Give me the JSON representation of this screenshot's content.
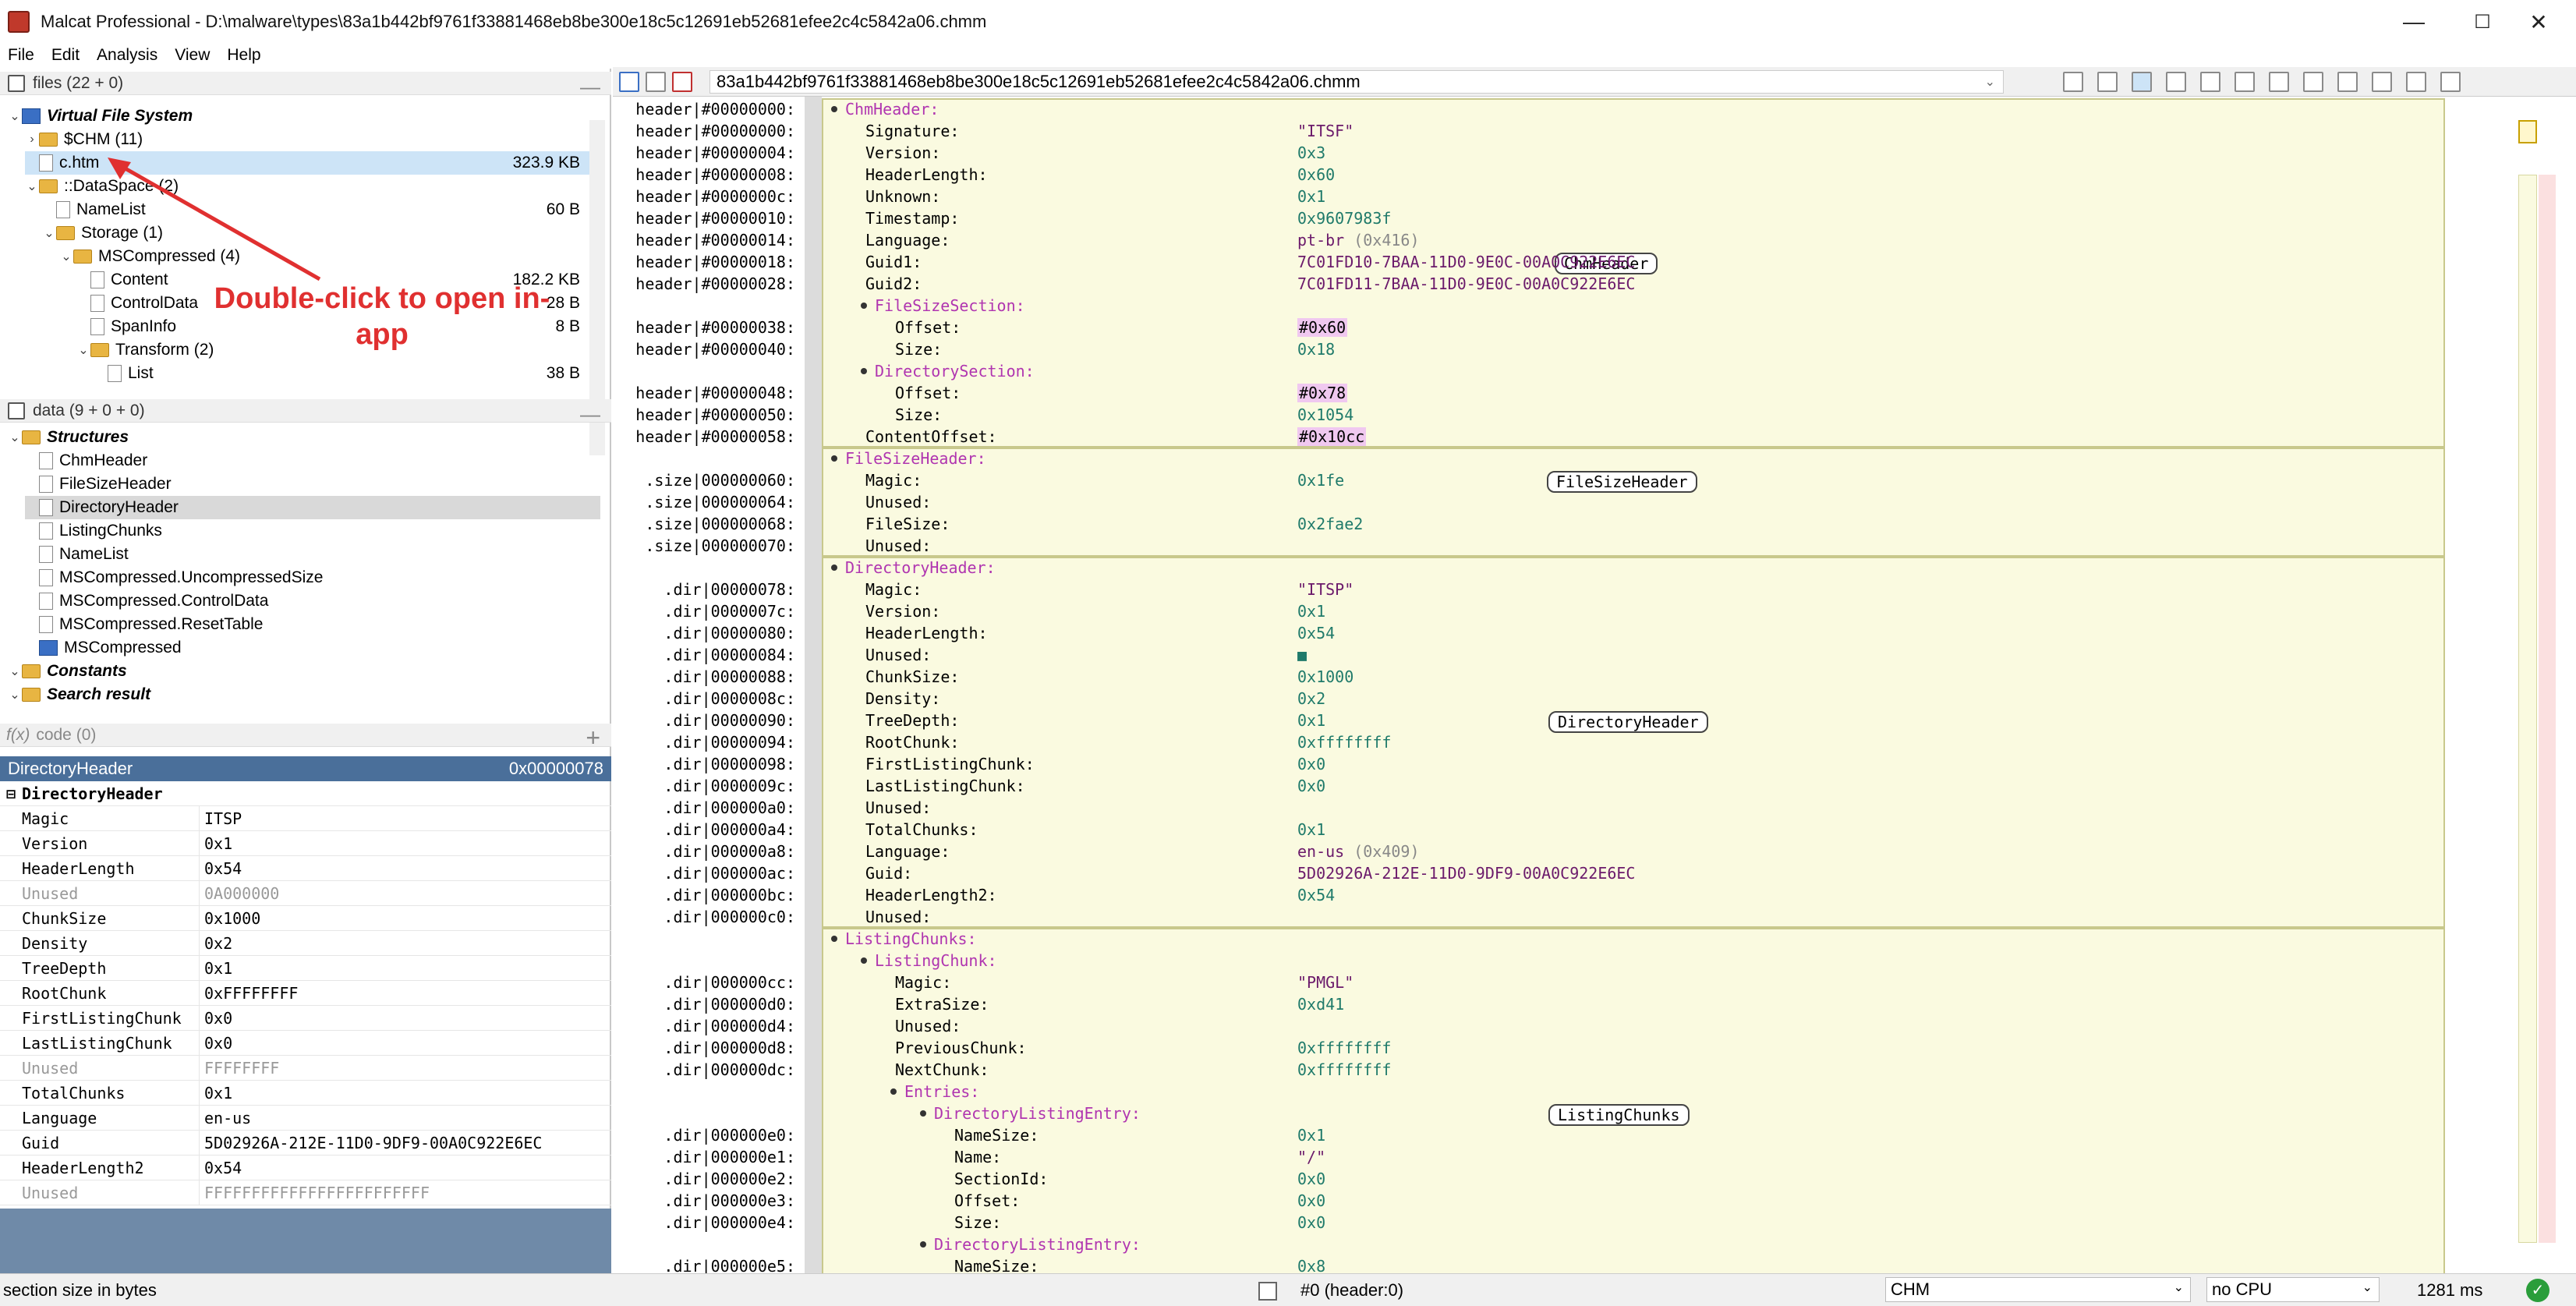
{
  "window": {
    "title": "Malcat Professional - D:\\malware\\types\\83a1b442bf9761f33881468eb8be300e18c5c12691eb52681efee2c4c5842a06.chmm",
    "min": "—",
    "max": "☐",
    "close": "✕"
  },
  "menu": [
    "File",
    "Edit",
    "Analysis",
    "View",
    "Help"
  ],
  "files_pane": {
    "header": "files (22 + 0)",
    "tree": [
      {
        "label": "Virtual File System",
        "kind": "vfs",
        "depth": 0,
        "tw": "v"
      },
      {
        "label": "$CHM (11)",
        "kind": "folder",
        "depth": 1,
        "tw": ">"
      },
      {
        "label": "c.htm",
        "kind": "file",
        "depth": 1,
        "tw": "",
        "size": "323.9 KB",
        "selected": true
      },
      {
        "label": "::DataSpace (2)",
        "kind": "folder",
        "depth": 1,
        "tw": "v"
      },
      {
        "label": "NameList",
        "kind": "file",
        "depth": 2,
        "tw": "",
        "size": "60 B"
      },
      {
        "label": "Storage (1)",
        "kind": "folder",
        "depth": 2,
        "tw": "v"
      },
      {
        "label": "MSCompressed (4)",
        "kind": "folder",
        "depth": 3,
        "tw": "v"
      },
      {
        "label": "Content",
        "kind": "file",
        "depth": 4,
        "tw": "",
        "size": "182.2 KB"
      },
      {
        "label": "ControlData",
        "kind": "file",
        "depth": 4,
        "tw": "",
        "size": "28 B"
      },
      {
        "label": "SpanInfo",
        "kind": "file",
        "depth": 4,
        "tw": "",
        "size": "8 B"
      },
      {
        "label": "Transform (2)",
        "kind": "folder",
        "depth": 4,
        "tw": "v"
      },
      {
        "label": "List",
        "kind": "file",
        "depth": 5,
        "tw": "",
        "size": "38 B"
      }
    ]
  },
  "data_pane": {
    "header": "data (9 + 0 + 0)",
    "tree": [
      {
        "label": "Structures",
        "kind": "group",
        "depth": 0
      },
      {
        "label": "ChmHeader",
        "kind": "file",
        "depth": 1
      },
      {
        "label": "FileSizeHeader",
        "kind": "file",
        "depth": 1
      },
      {
        "label": "DirectoryHeader",
        "kind": "file",
        "depth": 1,
        "selected": true
      },
      {
        "label": "ListingChunks",
        "kind": "file",
        "depth": 1
      },
      {
        "label": "NameList",
        "kind": "file",
        "depth": 1
      },
      {
        "label": "MSCompressed.UncompressedSize",
        "kind": "file",
        "depth": 1
      },
      {
        "label": "MSCompressed.ControlData",
        "kind": "file",
        "depth": 1
      },
      {
        "label": "MSCompressed.ResetTable",
        "kind": "file",
        "depth": 1
      },
      {
        "label": "MSCompressed",
        "kind": "struct",
        "depth": 1
      },
      {
        "label": "Constants",
        "kind": "group",
        "depth": 0
      },
      {
        "label": "Search result",
        "kind": "group",
        "depth": 0
      }
    ]
  },
  "code_pane": {
    "header": "code (0)",
    "fx": "f(x)",
    "plus": "+"
  },
  "props": {
    "title": "DirectoryHeader",
    "offset": "0x00000078",
    "group": "DirectoryHeader",
    "rows": [
      {
        "k": "Magic",
        "v": "ITSP"
      },
      {
        "k": "Version",
        "v": "0x1"
      },
      {
        "k": "HeaderLength",
        "v": "0x54"
      },
      {
        "k": "Unused",
        "v": "0A000000",
        "dim": true
      },
      {
        "k": "ChunkSize",
        "v": "0x1000"
      },
      {
        "k": "Density",
        "v": "0x2"
      },
      {
        "k": "TreeDepth",
        "v": "0x1"
      },
      {
        "k": "RootChunk",
        "v": "0xFFFFFFFF"
      },
      {
        "k": "FirstListingChunk",
        "v": "0x0"
      },
      {
        "k": "LastListingChunk",
        "v": "0x0"
      },
      {
        "k": "Unused",
        "v": "FFFFFFFF",
        "dim": true
      },
      {
        "k": "TotalChunks",
        "v": "0x1"
      },
      {
        "k": "Language",
        "v": "en-us"
      },
      {
        "k": "Guid",
        "v": "5D02926A-212E-11D0-9DF9-00A0C922E6EC"
      },
      {
        "k": "HeaderLength2",
        "v": "0x54"
      },
      {
        "k": "Unused",
        "v": "FFFFFFFFFFFFFFFFFFFFFFFF",
        "dim": true
      }
    ]
  },
  "annotation": {
    "text": "Double-click to open in-app"
  },
  "toolbar": {
    "filename": "83a1b442bf9761f33881468eb8be300e18c5c12691eb52681efee2c4c5842a06.chmm"
  },
  "status": {
    "left": "section size in bytes",
    "pos": "#0 (header:0)",
    "format": "CHM",
    "cpu": "no CPU",
    "time": "1281 ms"
  },
  "struct_view": [
    {
      "a": "header|#00000000:",
      "lbl": "ChmHeader:",
      "lvl": 0,
      "hd": true,
      "bullet": true,
      "hdrow": true
    },
    {
      "a": "header|#00000000:",
      "lbl": "Signature:",
      "lvl": 1,
      "v": "\"ITSF\"",
      "vt": "str"
    },
    {
      "a": "header|#00000004:",
      "lbl": "Version:",
      "lvl": 1,
      "v": "0x3",
      "vt": "num"
    },
    {
      "a": "header|#00000008:",
      "lbl": "HeaderLength:",
      "lvl": 1,
      "v": "0x60",
      "vt": "num"
    },
    {
      "a": "header|#0000000c:",
      "lbl": "Unknown:",
      "lvl": 1,
      "v": "0x1",
      "vt": "num"
    },
    {
      "a": "header|#00000010:",
      "lbl": "Timestamp:",
      "lvl": 1,
      "v": "0x9607983f",
      "vt": "num"
    },
    {
      "a": "header|#00000014:",
      "lbl": "Language:",
      "lvl": 1,
      "v": "pt-br",
      "v2": "(0x416)",
      "vt": "str"
    },
    {
      "a": "header|#00000018:",
      "lbl": "Guid1:",
      "lvl": 1,
      "v": "7C01FD10-7BAA-11D0-9E0C-00A0C922E6EC",
      "vt": "str"
    },
    {
      "a": "header|#00000028:",
      "lbl": "Guid2:",
      "lvl": 1,
      "v": "7C01FD11-7BAA-11D0-9E0C-00A0C922E6EC",
      "vt": "str"
    },
    {
      "a": "",
      "lbl": "FileSizeSection:",
      "lvl": 1,
      "hd": true,
      "bullet": true
    },
    {
      "a": "header|#00000038:",
      "lbl": "Offset:",
      "lvl": 2,
      "v": "#0x60",
      "vt": "ptr"
    },
    {
      "a": "header|#00000040:",
      "lbl": "Size:",
      "lvl": 2,
      "v": "0x18",
      "vt": "num"
    },
    {
      "a": "",
      "lbl": "DirectorySection:",
      "lvl": 1,
      "hd": true,
      "bullet": true
    },
    {
      "a": "header|#00000048:",
      "lbl": "Offset:",
      "lvl": 2,
      "v": "#0x78",
      "vt": "ptr"
    },
    {
      "a": "header|#00000050:",
      "lbl": "Size:",
      "lvl": 2,
      "v": "0x1054",
      "vt": "num"
    },
    {
      "a": "header|#00000058:",
      "lbl": "ContentOffset:",
      "lvl": 1,
      "v": "#0x10cc",
      "vt": "ptr"
    },
    {
      "a": "",
      "lbl": "FileSizeHeader:",
      "lvl": 0,
      "hd": true,
      "bullet": true,
      "hdrow": true
    },
    {
      "a": ".size|000000060:",
      "lbl": "Magic:",
      "lvl": 1,
      "v": "0x1fe",
      "vt": "num"
    },
    {
      "a": ".size|000000064:",
      "lbl": "Unused:",
      "lvl": 1,
      "v": "",
      "vt": "num"
    },
    {
      "a": ".size|000000068:",
      "lbl": "FileSize:",
      "lvl": 1,
      "v": "0x2fae2",
      "vt": "num"
    },
    {
      "a": ".size|000000070:",
      "lbl": "Unused:",
      "lvl": 1,
      "v": "",
      "vt": "num"
    },
    {
      "a": "",
      "lbl": "DirectoryHeader:",
      "lvl": 0,
      "hd": true,
      "bullet": true,
      "hdrow": true
    },
    {
      "a": ".dir|00000078:",
      "lbl": "Magic:",
      "lvl": 1,
      "v": "\"ITSP\"",
      "vt": "str"
    },
    {
      "a": ".dir|0000007c:",
      "lbl": "Version:",
      "lvl": 1,
      "v": "0x1",
      "vt": "num"
    },
    {
      "a": ".dir|00000080:",
      "lbl": "HeaderLength:",
      "lvl": 1,
      "v": "0x54",
      "vt": "num"
    },
    {
      "a": ".dir|00000084:",
      "lbl": "Unused:",
      "lvl": 1,
      "v": "■",
      "vt": "num"
    },
    {
      "a": ".dir|00000088:",
      "lbl": "ChunkSize:",
      "lvl": 1,
      "v": "0x1000",
      "vt": "num"
    },
    {
      "a": ".dir|0000008c:",
      "lbl": "Density:",
      "lvl": 1,
      "v": "0x2",
      "vt": "num"
    },
    {
      "a": ".dir|00000090:",
      "lbl": "TreeDepth:",
      "lvl": 1,
      "v": "0x1",
      "vt": "num"
    },
    {
      "a": ".dir|00000094:",
      "lbl": "RootChunk:",
      "lvl": 1,
      "v": "0xffffffff",
      "vt": "num"
    },
    {
      "a": ".dir|00000098:",
      "lbl": "FirstListingChunk:",
      "lvl": 1,
      "v": "0x0",
      "vt": "num"
    },
    {
      "a": ".dir|0000009c:",
      "lbl": "LastListingChunk:",
      "lvl": 1,
      "v": "0x0",
      "vt": "num"
    },
    {
      "a": ".dir|000000a0:",
      "lbl": "Unused:",
      "lvl": 1,
      "v": "",
      "vt": "num"
    },
    {
      "a": ".dir|000000a4:",
      "lbl": "TotalChunks:",
      "lvl": 1,
      "v": "0x1",
      "vt": "num"
    },
    {
      "a": ".dir|000000a8:",
      "lbl": "Language:",
      "lvl": 1,
      "v": "en-us",
      "v2": "(0x409)",
      "vt": "str"
    },
    {
      "a": ".dir|000000ac:",
      "lbl": "Guid:",
      "lvl": 1,
      "v": "5D02926A-212E-11D0-9DF9-00A0C922E6EC",
      "vt": "str"
    },
    {
      "a": ".dir|000000bc:",
      "lbl": "HeaderLength2:",
      "lvl": 1,
      "v": "0x54",
      "vt": "num"
    },
    {
      "a": ".dir|000000c0:",
      "lbl": "Unused:",
      "lvl": 1,
      "v": "",
      "vt": "num"
    },
    {
      "a": "",
      "lbl": "ListingChunks:",
      "lvl": 0,
      "hd": true,
      "bullet": true,
      "hdrow": true
    },
    {
      "a": "",
      "lbl": "ListingChunk:",
      "lvl": 1,
      "hd": true,
      "bullet": true
    },
    {
      "a": ".dir|000000cc:",
      "lbl": "Magic:",
      "lvl": 2,
      "v": "\"PMGL\"",
      "vt": "str"
    },
    {
      "a": ".dir|000000d0:",
      "lbl": "ExtraSize:",
      "lvl": 2,
      "v": "0xd41",
      "vt": "num"
    },
    {
      "a": ".dir|000000d4:",
      "lbl": "Unused:",
      "lvl": 2,
      "v": "",
      "vt": "num"
    },
    {
      "a": ".dir|000000d8:",
      "lbl": "PreviousChunk:",
      "lvl": 2,
      "v": "0xffffffff",
      "vt": "num"
    },
    {
      "a": ".dir|000000dc:",
      "lbl": "NextChunk:",
      "lvl": 2,
      "v": "0xffffffff",
      "vt": "num"
    },
    {
      "a": "",
      "lbl": "Entries:",
      "lvl": 2,
      "hd": true,
      "bullet": true
    },
    {
      "a": "",
      "lbl": "DirectoryListingEntry:",
      "lvl": 3,
      "hd": true,
      "bullet": true
    },
    {
      "a": ".dir|000000e0:",
      "lbl": "NameSize:",
      "lvl": 4,
      "v": "0x1",
      "vt": "num"
    },
    {
      "a": ".dir|000000e1:",
      "lbl": "Name:",
      "lvl": 4,
      "v": "\"/\"",
      "vt": "str"
    },
    {
      "a": ".dir|000000e2:",
      "lbl": "SectionId:",
      "lvl": 4,
      "v": "0x0",
      "vt": "num"
    },
    {
      "a": ".dir|000000e3:",
      "lbl": "Offset:",
      "lvl": 4,
      "v": "0x0",
      "vt": "num"
    },
    {
      "a": ".dir|000000e4:",
      "lbl": "Size:",
      "lvl": 4,
      "v": "0x0",
      "vt": "num"
    },
    {
      "a": "",
      "lbl": "DirectoryListingEntry:",
      "lvl": 3,
      "hd": true,
      "bullet": true
    },
    {
      "a": ".dir|000000e5:",
      "lbl": "NameSize:",
      "lvl": 4,
      "v": "0x8",
      "vt": "num"
    }
  ],
  "struct_tags": [
    "ChmHeader",
    "FileSizeHeader",
    "DirectoryHeader",
    "ListingChunks"
  ]
}
